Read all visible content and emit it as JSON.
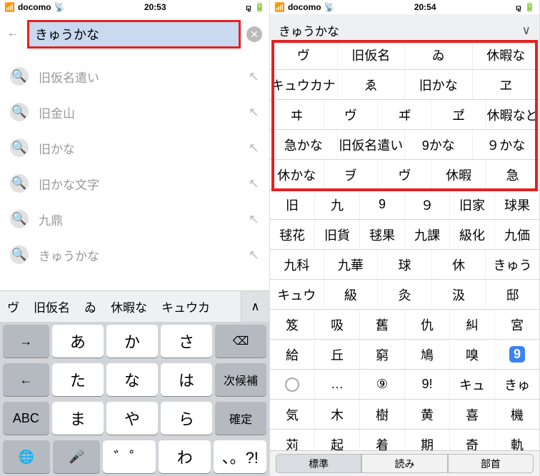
{
  "left": {
    "status": {
      "carrier": "docomo",
      "time": "20:53"
    },
    "search_text": "きゅうかな",
    "suggestions": [
      "旧仮名遣い",
      "旧金山",
      "旧かな",
      "旧かな文字",
      "九鼎",
      "きゅうかな"
    ],
    "candidates": [
      "ヴ",
      "旧仮名",
      "ゐ",
      "休暇な",
      "キュウカ"
    ],
    "keyboard": {
      "rows": [
        [
          "→",
          "あ",
          "か",
          "さ",
          "⌫"
        ],
        [
          "←",
          "た",
          "な",
          "は",
          "次候補"
        ],
        [
          "ABC",
          "ま",
          "や",
          "ら",
          "確定"
        ],
        [
          "🌐",
          "🎤",
          "゛゜",
          "わ",
          "、。?!",
          ""
        ]
      ]
    }
  },
  "right": {
    "status": {
      "carrier": "docomo",
      "time": "20:54"
    },
    "header": "きゅうかな",
    "grid": [
      [
        "ヴ",
        "旧仮名",
        "ゐ",
        "休暇な"
      ],
      [
        "キュウカナ",
        "ゑ",
        "旧かな",
        "ヱ"
      ],
      [
        "ヰ",
        "ヴ",
        "ヸ",
        "ヹ",
        "休暇など"
      ],
      [
        "急かな",
        "旧仮名遣い",
        "9かな",
        "９かな"
      ],
      [
        "休かな",
        "ヺ",
        "ヴ",
        "休暇",
        "急"
      ],
      [
        "旧",
        "九",
        "9",
        "９",
        "旧家",
        "球果"
      ],
      [
        "毬花",
        "旧貨",
        "毬果",
        "九課",
        "級化",
        "九価"
      ],
      [
        "九科",
        "九華",
        "球",
        "休",
        "きゅう"
      ],
      [
        "キュウ",
        "級",
        "灸",
        "汲",
        "邸"
      ],
      [
        "笈",
        "吸",
        "舊",
        "仇",
        "糾",
        "宮"
      ],
      [
        "給",
        "丘",
        "窮",
        "鳩",
        "嗅",
        "⑨"
      ],
      [
        "🕐",
        "…",
        "⑨",
        "9!",
        "キュ",
        "きゅ"
      ],
      [
        "気",
        "木",
        "樹",
        "黄",
        "喜",
        "機"
      ],
      [
        "苅",
        "起",
        "着",
        "期",
        "奇",
        "軌"
      ]
    ],
    "segments": [
      "標準",
      "読み",
      "部首"
    ]
  }
}
